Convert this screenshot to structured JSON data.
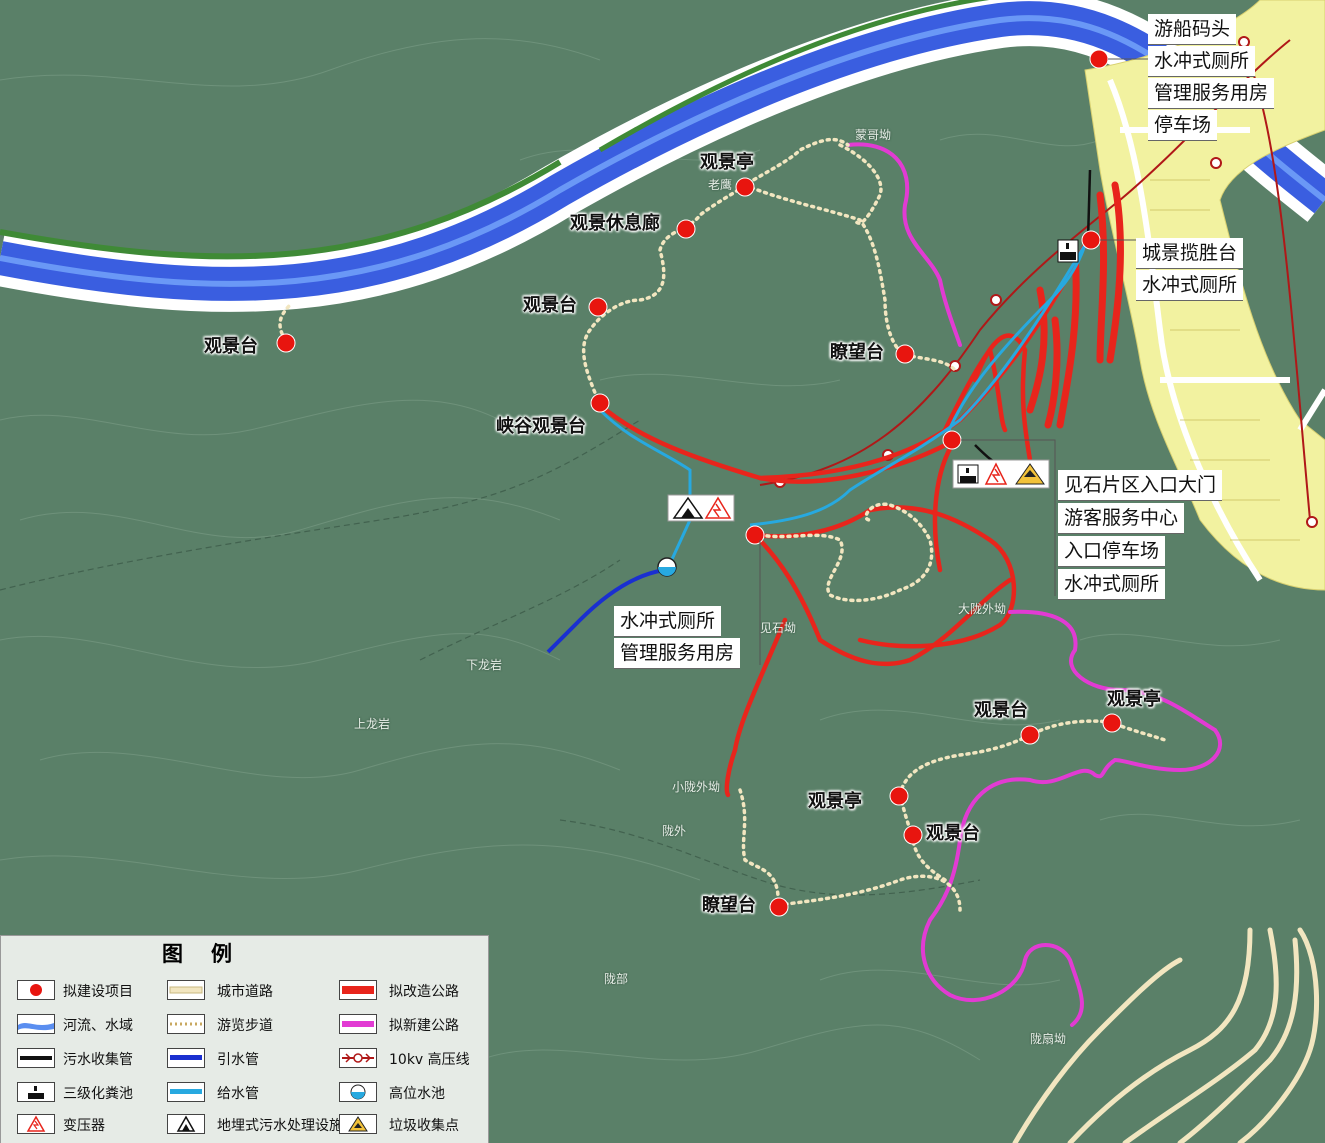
{
  "labels": {
    "viewpoint_left": "观景台",
    "pavilion_top": "观景亭",
    "corridor": "观景休息廊",
    "viewpoint_mid": "观景台",
    "canyon": "峡谷观景台",
    "lookout_top": "瞭望台",
    "pavilion_se1": "观景亭",
    "viewpoint_se1": "观景台",
    "pavilion_se2": "观景亭",
    "viewpoint_se2": "观景台",
    "lookout_bottom": "瞭望台"
  },
  "callouts": {
    "dock": [
      "游船码头",
      "水冲式厕所",
      "管理服务用房",
      "停车场"
    ],
    "city_view": [
      "城景揽胜台",
      "水冲式厕所"
    ],
    "entrance": [
      "见石片区入口大门",
      "游客服务中心",
      "入口停车场",
      "水冲式厕所"
    ],
    "center": [
      "水冲式厕所",
      "管理服务用房"
    ]
  },
  "places": {
    "mengge": "蒙哥坳",
    "laoying": "老鹰",
    "jianshi": "见石坳",
    "dalong": "大陇外坳",
    "xiaolong": "小陇外坳",
    "longwai": "陇外",
    "shanglongyan": "上龙岩",
    "longbu": "陇部",
    "longshan": "陇扇坳",
    "xialong": "下龙岩"
  },
  "legend": {
    "title": "图例",
    "items": [
      {
        "label": "拟建设项目",
        "icon": "red-dot-icon"
      },
      {
        "label": "城市道路",
        "icon": "city-road-icon"
      },
      {
        "label": "拟改造公路",
        "icon": "red-road-icon"
      },
      {
        "label": "河流、水域",
        "icon": "river-icon"
      },
      {
        "label": "游览步道",
        "icon": "trail-icon"
      },
      {
        "label": "拟新建公路",
        "icon": "magenta-road-icon"
      },
      {
        "label": "污水收集管",
        "icon": "sewage-pipe-icon"
      },
      {
        "label": "引水管",
        "icon": "intake-pipe-icon"
      },
      {
        "label": "10kv 高压线",
        "icon": "power-line-icon"
      },
      {
        "label": "三级化粪池",
        "icon": "septic-tank-icon"
      },
      {
        "label": "给水管",
        "icon": "water-supply-pipe-icon"
      },
      {
        "label": "高位水池",
        "icon": "water-tank-icon"
      },
      {
        "label": "变压器",
        "icon": "transformer-icon"
      },
      {
        "label": "地埋式污水处理设施",
        "icon": "sewage-plant-icon"
      },
      {
        "label": "垃圾收集点",
        "icon": "garbage-point-icon"
      }
    ]
  },
  "colors": {
    "terrain": "#5a8068",
    "river": "#3a5ee0",
    "riverbank": "#ffffff",
    "city": "#f2f2a0",
    "red_road": "#e8251c",
    "new_road": "#e23bd3",
    "trail": "#f2e6c0",
    "water_pipe": "#27a9e0",
    "intake_pipe": "#1a2fd0",
    "power_line": "#b01818"
  }
}
